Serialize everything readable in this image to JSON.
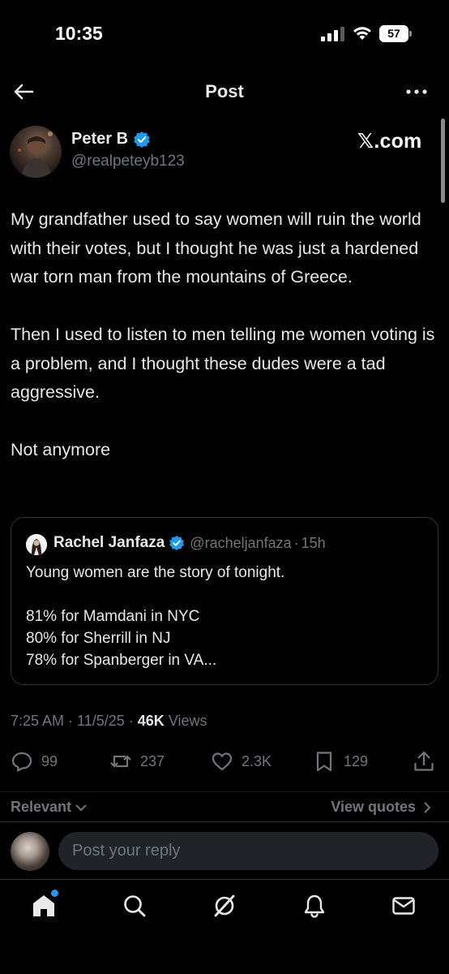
{
  "status_bar": {
    "time": "10:35",
    "battery": "57"
  },
  "header": {
    "title": "Post",
    "back_icon": "arrow-left-icon",
    "more_icon": "more-horizontal-icon"
  },
  "post": {
    "author": {
      "name": "Peter B",
      "handle": "@realpeteyb123",
      "verified": true
    },
    "watermark": "𝕏.com",
    "paragraphs": [
      "My grandfather used to say women will ruin the world with their votes, but I thought he was just a hardened war torn man from the mountains of Greece.",
      "Then I used to listen to men telling me women voting is a problem, and I thought these dudes were a tad aggressive.",
      "Not anymore"
    ],
    "quote": {
      "name": "Rachel Janfaza",
      "handle": "@racheljanfaza",
      "separator": "·",
      "time": "15h",
      "lines": [
        "Young women are the story of tonight.",
        "",
        "81% for Mamdani in NYC",
        "80% for Sherrill in NJ",
        "78% for Spanberger in VA..."
      ]
    },
    "meta": {
      "time": "7:25 AM",
      "sep1": " · ",
      "date": "11/5/25",
      "sep2": " · ",
      "views_count": "46K",
      "views_label": " Views"
    },
    "actions": {
      "replies": "99",
      "reposts": "237",
      "likes": "2.3K",
      "bookmarks": "129"
    }
  },
  "sort": {
    "label": "Relevant",
    "view_quotes": "View quotes"
  },
  "reply": {
    "placeholder": "Post your reply"
  },
  "nav": {
    "items": [
      "home-icon",
      "search-icon",
      "grok-icon",
      "notifications-icon",
      "messages-icon"
    ]
  },
  "colors": {
    "background": "#000000",
    "text": "#e7e9ea",
    "secondary": "#71767b",
    "accent": "#1d9bf0",
    "border": "#2f3336"
  }
}
